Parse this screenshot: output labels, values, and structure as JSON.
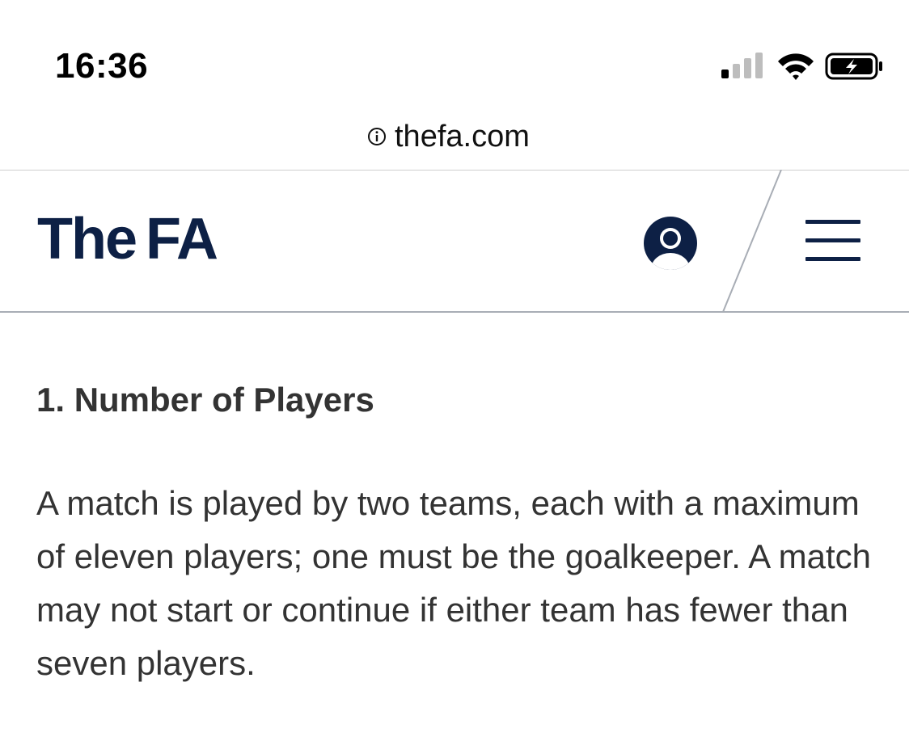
{
  "status_bar": {
    "time": "16:36",
    "signal_icon": "cellular-signal-icon",
    "wifi_icon": "wifi-icon",
    "battery_icon": "battery-charging-icon"
  },
  "browser": {
    "url": "thefa.com",
    "info_icon": "info-icon"
  },
  "header": {
    "logo_part1": "The",
    "logo_part2": "FA",
    "account_icon": "user-account-icon",
    "menu_icon": "hamburger-menu-icon"
  },
  "article": {
    "heading": "1. Number of Players",
    "body": "A match is played by two teams, each with a maximum of eleven players; one must be the goalkeeper. A match may not start or continue if either team has fewer than seven players."
  },
  "colors": {
    "brand_navy": "#0d2045",
    "text": "#333333",
    "rule": "#a8adb5"
  }
}
